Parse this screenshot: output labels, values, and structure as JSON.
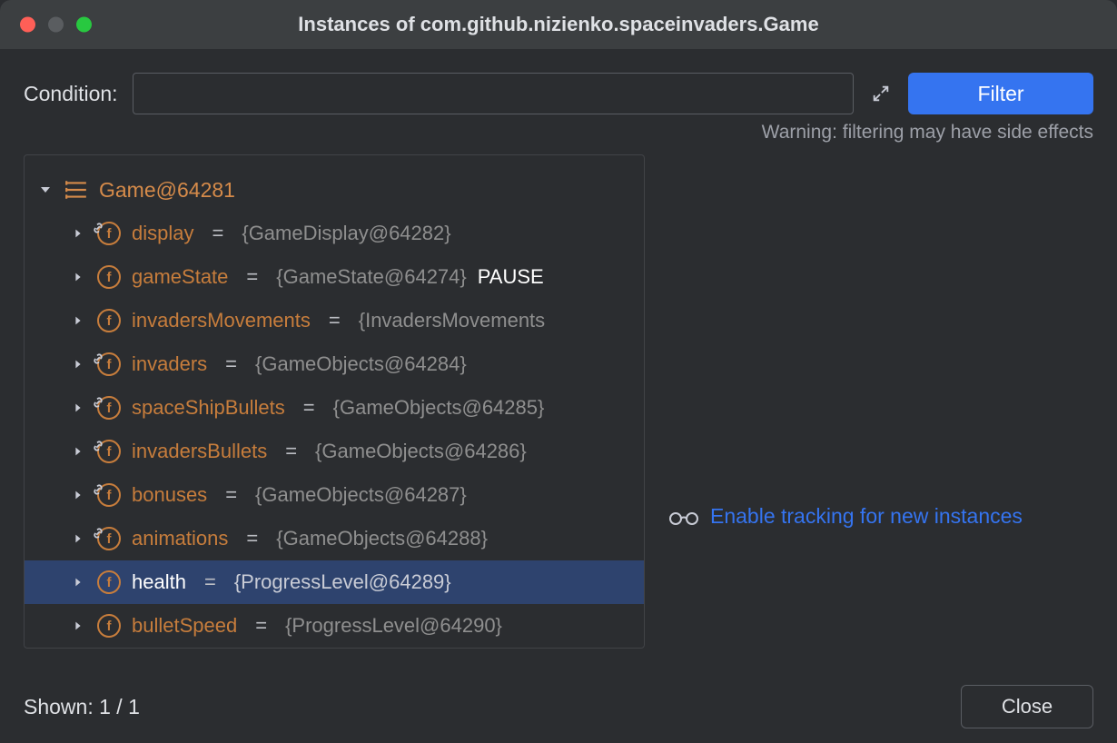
{
  "window": {
    "title": "Instances of com.github.nizienko.spaceinvaders.Game"
  },
  "filter": {
    "label": "Condition:",
    "value": "",
    "button": "Filter",
    "warning": "Warning: filtering may have side effects"
  },
  "tree": {
    "root": {
      "label": "Game@64281"
    },
    "items": [
      {
        "name": "display",
        "eq": "=",
        "value": "{GameDisplay@64282}",
        "suffix": "",
        "linked": true,
        "selected": false
      },
      {
        "name": "gameState",
        "eq": "=",
        "value": "{GameState@64274}",
        "suffix": " PAUSE",
        "linked": false,
        "selected": false
      },
      {
        "name": "invadersMovements",
        "eq": "=",
        "value": "{InvadersMovements",
        "suffix": "",
        "linked": false,
        "selected": false
      },
      {
        "name": "invaders",
        "eq": "=",
        "value": "{GameObjects@64284}",
        "suffix": "",
        "linked": true,
        "selected": false
      },
      {
        "name": "spaceShipBullets",
        "eq": "=",
        "value": "{GameObjects@64285}",
        "suffix": "",
        "linked": true,
        "selected": false
      },
      {
        "name": "invadersBullets",
        "eq": "=",
        "value": "{GameObjects@64286}",
        "suffix": "",
        "linked": true,
        "selected": false
      },
      {
        "name": "bonuses",
        "eq": "=",
        "value": "{GameObjects@64287}",
        "suffix": "",
        "linked": true,
        "selected": false
      },
      {
        "name": "animations",
        "eq": "=",
        "value": "{GameObjects@64288}",
        "suffix": "",
        "linked": true,
        "selected": false
      },
      {
        "name": "health",
        "eq": "=",
        "value": "{ProgressLevel@64289}",
        "suffix": "",
        "linked": false,
        "selected": true
      },
      {
        "name": "bulletSpeed",
        "eq": "=",
        "value": "{ProgressLevel@64290}",
        "suffix": "",
        "linked": false,
        "selected": false
      }
    ]
  },
  "tracking": {
    "label": "Enable tracking for new instances"
  },
  "footer": {
    "shown": "Shown: 1 / 1",
    "close": "Close"
  }
}
